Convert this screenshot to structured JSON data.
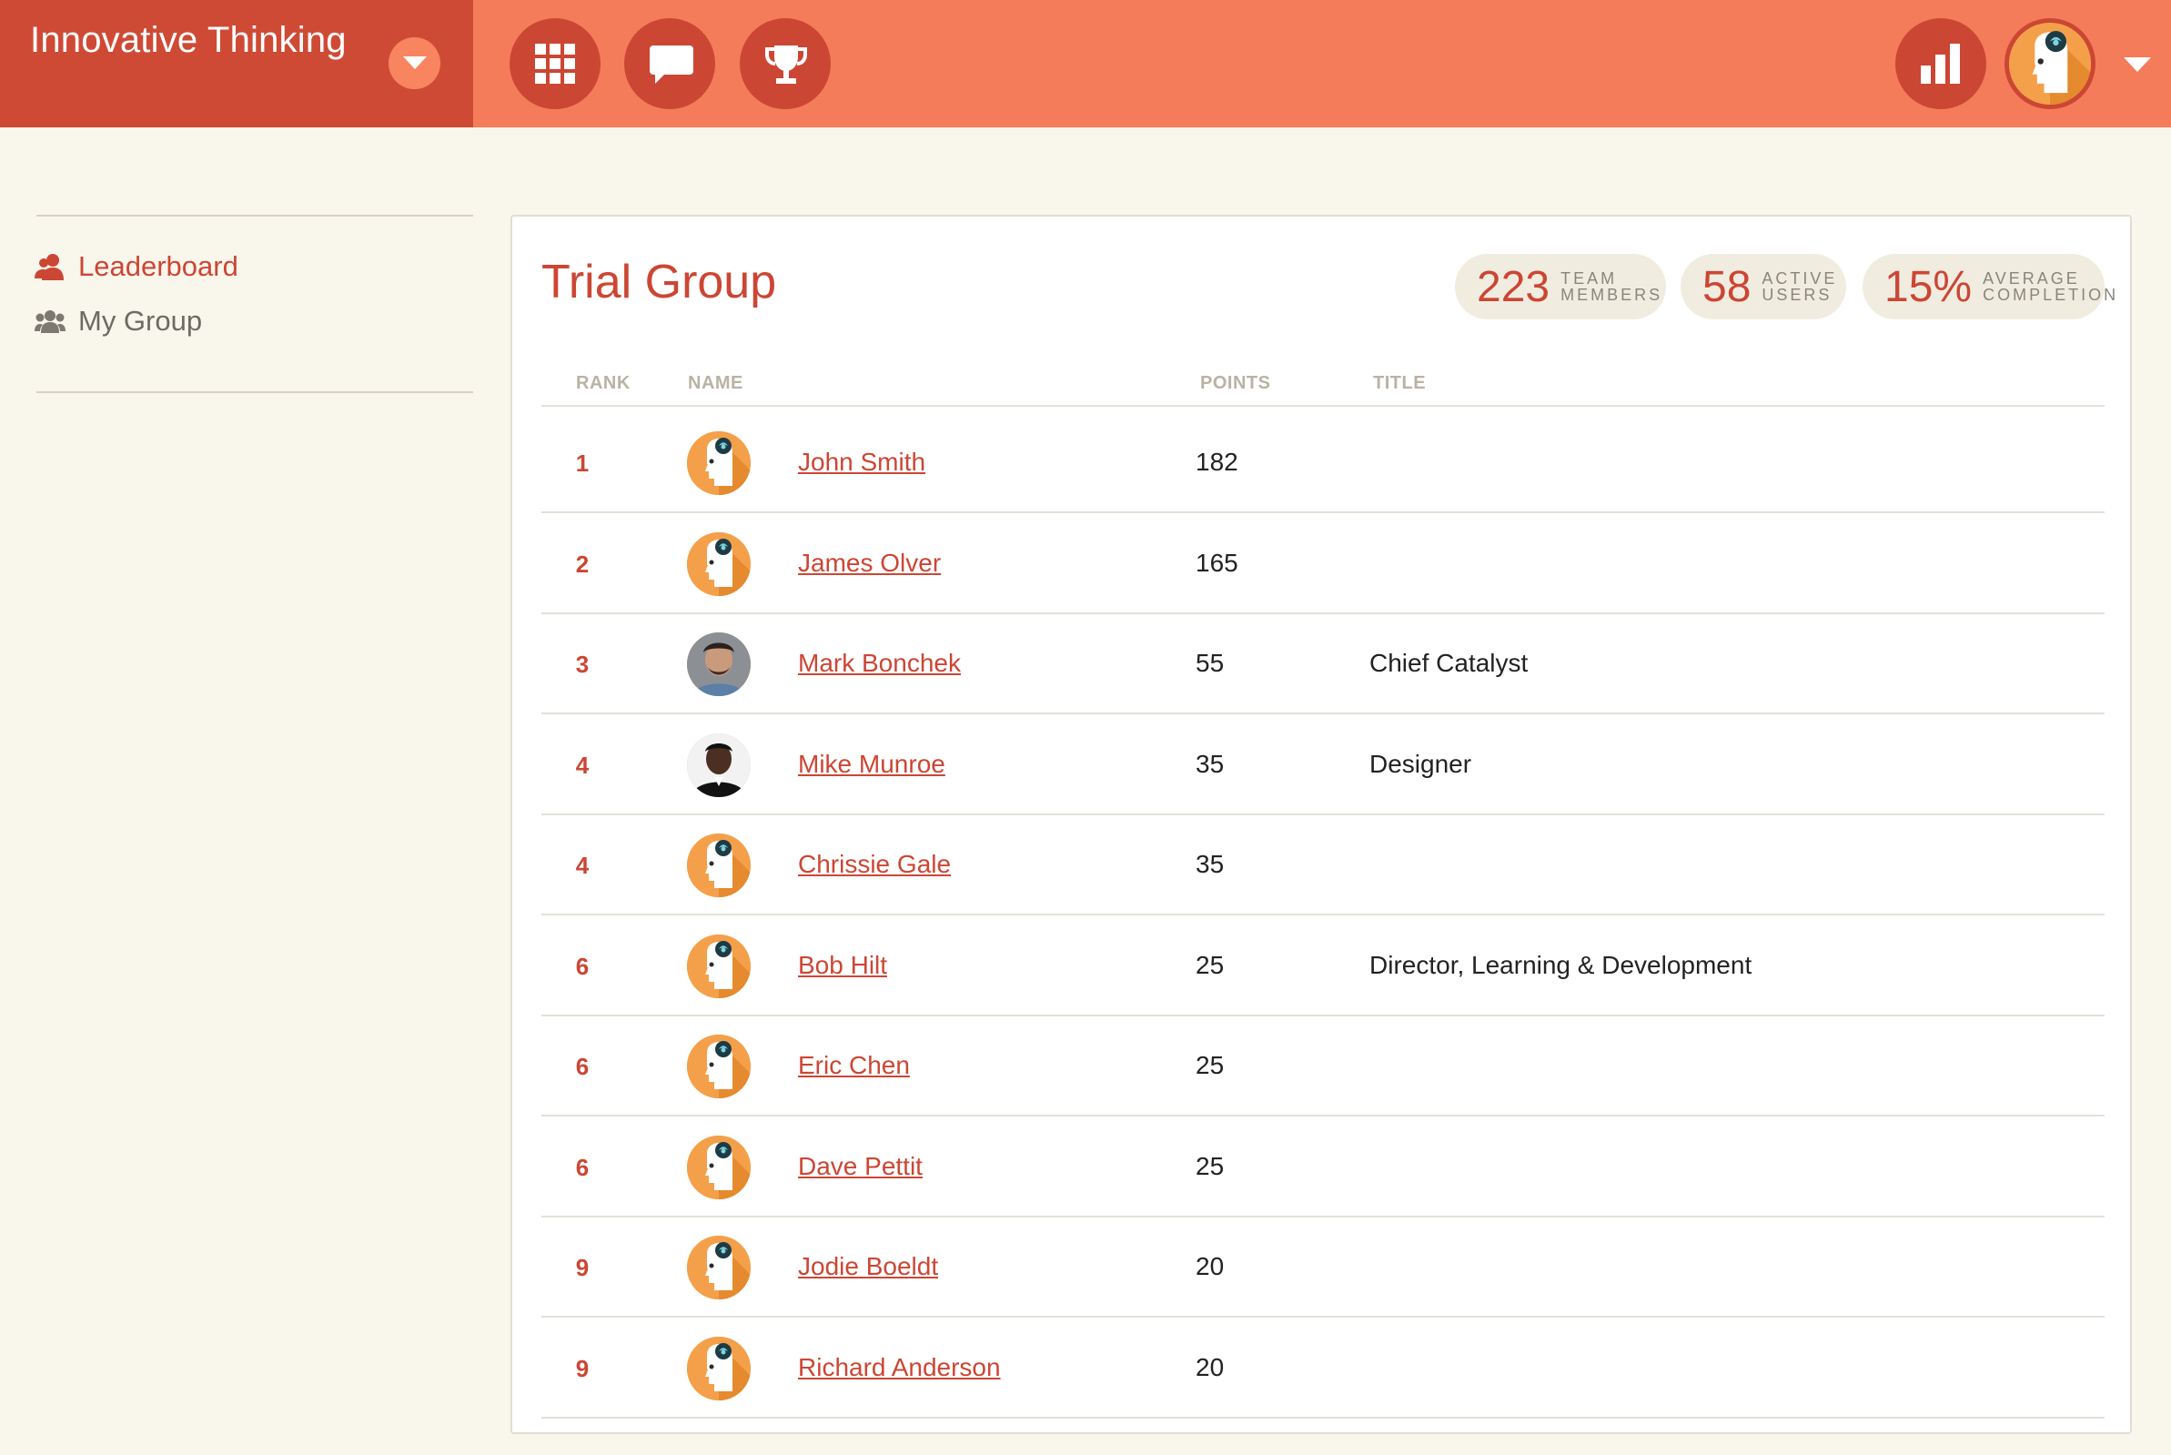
{
  "brand": {
    "name": "Innovative Thinking"
  },
  "nav": {
    "icons": [
      "grid-icon",
      "chat-icon",
      "trophy-icon"
    ],
    "right_icons": [
      "bar-chart-icon",
      "user-avatar"
    ]
  },
  "sidebar": {
    "items": [
      {
        "label": "Leaderboard",
        "icon": "users-icon",
        "active": true
      },
      {
        "label": "My Group",
        "icon": "group-icon",
        "active": false
      }
    ]
  },
  "main": {
    "title": "Trial Group",
    "stats": [
      {
        "value": "223",
        "label_top": "TEAM",
        "label_bottom": "MEMBERS"
      },
      {
        "value": "58",
        "label_top": "ACTIVE",
        "label_bottom": "USERS"
      },
      {
        "value": "15%",
        "label_top": "AVERAGE",
        "label_bottom": "COMPLETION"
      }
    ],
    "columns": {
      "rank": "RANK",
      "name": "NAME",
      "points": "POINTS",
      "title": "TITLE"
    },
    "rows": [
      {
        "rank": "1",
        "name": "John Smith",
        "points": "182",
        "title": "",
        "avatar": "default-head"
      },
      {
        "rank": "2",
        "name": "James Olver",
        "points": "165",
        "title": "",
        "avatar": "default-head"
      },
      {
        "rank": "3",
        "name": "Mark Bonchek",
        "points": "55",
        "title": "Chief Catalyst",
        "avatar": "photo"
      },
      {
        "rank": "4",
        "name": "Mike Munroe",
        "points": "35",
        "title": "Designer",
        "avatar": "photo"
      },
      {
        "rank": "4",
        "name": "Chrissie Gale",
        "points": "35",
        "title": "",
        "avatar": "default-head"
      },
      {
        "rank": "6",
        "name": "Bob Hilt",
        "points": "25",
        "title": "Director, Learning & Development",
        "avatar": "default-head"
      },
      {
        "rank": "6",
        "name": "Eric Chen",
        "points": "25",
        "title": "",
        "avatar": "default-head"
      },
      {
        "rank": "6",
        "name": "Dave Pettit",
        "points": "25",
        "title": "",
        "avatar": "default-head"
      },
      {
        "rank": "9",
        "name": "Jodie Boeldt",
        "points": "20",
        "title": "",
        "avatar": "default-head"
      },
      {
        "rank": "9",
        "name": "Richard Anderson",
        "points": "20",
        "title": "",
        "avatar": "default-head"
      }
    ]
  },
  "colors": {
    "header": "#f47c5a",
    "brand_bg": "#cf4a35",
    "accent": "#cc4634",
    "page_bg": "#f9f6ec",
    "avatar_orange": "#f4a04a"
  }
}
